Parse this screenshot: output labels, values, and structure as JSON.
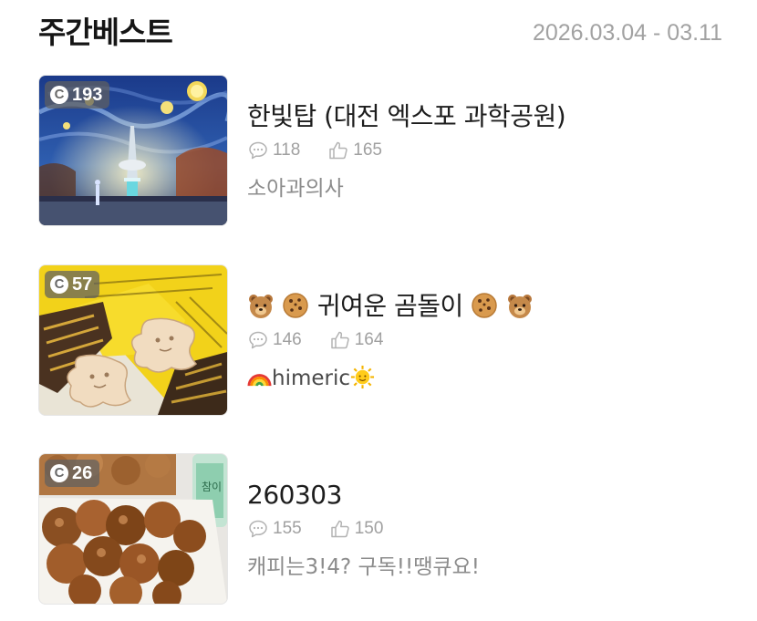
{
  "header": {
    "title": "주간베스트",
    "date_range": "2026.03.04 - 03.11"
  },
  "posts": [
    {
      "badge_count": "193",
      "title": "한빛탑 (대전 엑스포 과학공원)",
      "comments": "118",
      "likes": "165",
      "author": "소아과의사"
    },
    {
      "badge_count": "57",
      "title_emoji_left": [
        "bear-face-icon",
        "cookie-icon"
      ],
      "title_text": "귀여운 곰돌이",
      "title_emoji_right": [
        "cookie-icon",
        "bear-face-icon"
      ],
      "comments": "146",
      "likes": "164",
      "author_emoji_left": "rainbow-icon",
      "author_text": "himeric",
      "author_emoji_right": "sun-face-icon"
    },
    {
      "badge_count": "26",
      "title": "260303",
      "comments": "155",
      "likes": "150",
      "author": "캐피는3!4? 구독!!땡큐요!"
    }
  ],
  "badge_icon_glyph": "C",
  "colors": {
    "title_text": "#151515",
    "date_text": "#a2a2a2",
    "meta_text": "#a0a0a0",
    "author_text": "#8c8c8c",
    "badge_bg": "#5f5f5f"
  }
}
